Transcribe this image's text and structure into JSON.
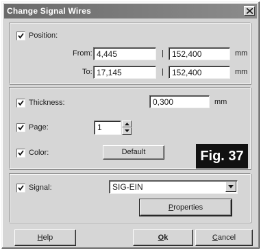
{
  "window": {
    "title": "Change Signal Wires",
    "close_icon": "close-icon"
  },
  "position": {
    "checkbox_label": "Position:",
    "checked": true,
    "from_label": "From:",
    "to_label": "To:",
    "separator": "|",
    "from_x": "4,445",
    "from_y": "152,400",
    "to_x": "17,145",
    "to_y": "152,400",
    "unit": "mm"
  },
  "thickness": {
    "label": "Thickness:",
    "checked": true,
    "value": "0,300",
    "unit": "mm"
  },
  "page": {
    "label": "Page:",
    "checked": true,
    "value": "1"
  },
  "color": {
    "label": "Color:",
    "checked": true,
    "button_label": "Default"
  },
  "figure_label": "Fig. 37",
  "signal": {
    "label": "Signal:",
    "checked": true,
    "value": "SIG-EIN",
    "properties_label_underlined": "P",
    "properties_label_rest": "roperties"
  },
  "footer": {
    "help_underlined": "H",
    "help_rest": "elp",
    "ok_underlined": "O",
    "ok_rest": "k",
    "cancel_underlined": "C",
    "cancel_rest": "ancel"
  }
}
